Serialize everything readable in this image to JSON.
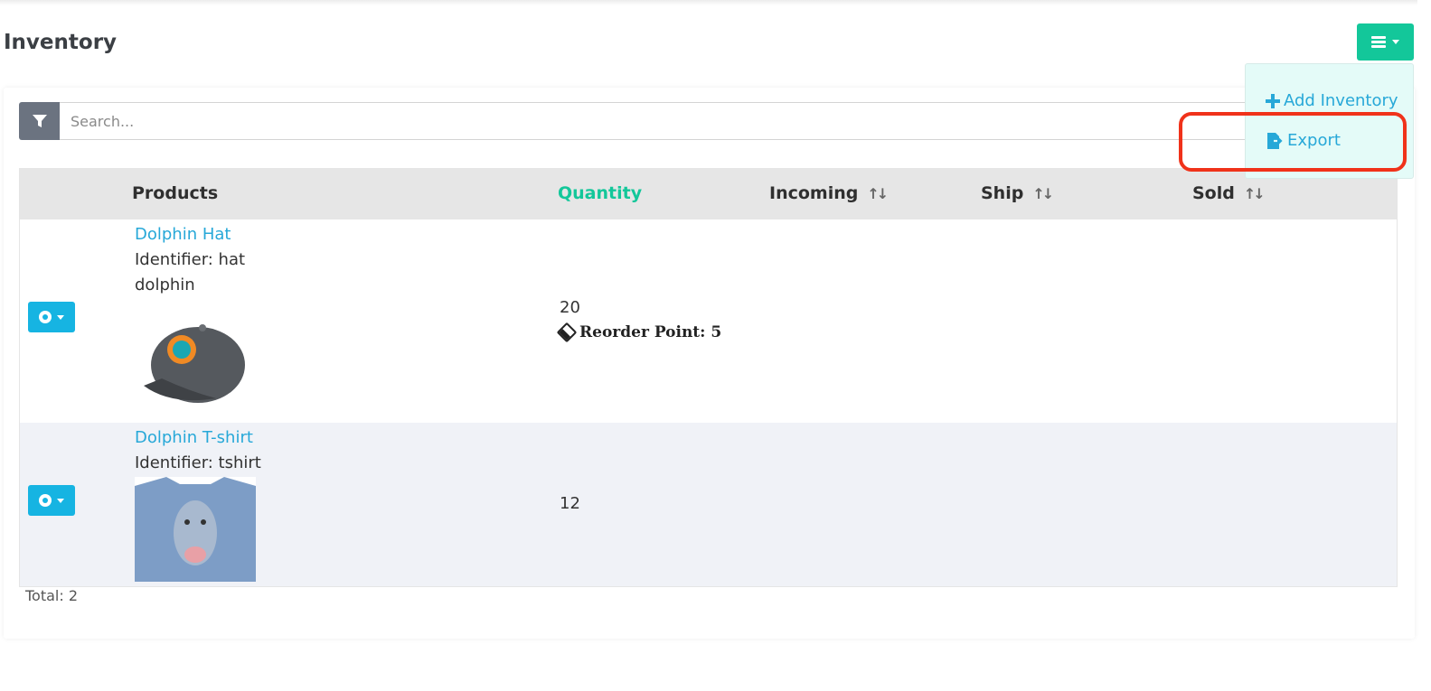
{
  "page": {
    "title": "Inventory"
  },
  "menu": {
    "items": [
      {
        "label": "Add Inventory",
        "icon": "plus-icon"
      },
      {
        "label": "Export",
        "icon": "file-export-icon"
      }
    ]
  },
  "search": {
    "placeholder": "Search..."
  },
  "table": {
    "headers": {
      "products": "Products",
      "quantity": "Quantity",
      "incoming": "Incoming",
      "ship": "Ship",
      "sold": "Sold"
    },
    "rows": [
      {
        "name": "Dolphin Hat",
        "identifier_line1": "Identifier: hat",
        "identifier_line2": "dolphin",
        "quantity": "20",
        "reorder": "Reorder Point: 5"
      },
      {
        "name": "Dolphin T-shirt",
        "identifier_line1": "Identifier: tshirt",
        "quantity": "12"
      }
    ]
  },
  "footer": {
    "total": "Total: 2"
  },
  "colors": {
    "accent": "#13c79a",
    "link": "#27a8d8",
    "action": "#16b4e2",
    "highlight": "#f0321a"
  }
}
